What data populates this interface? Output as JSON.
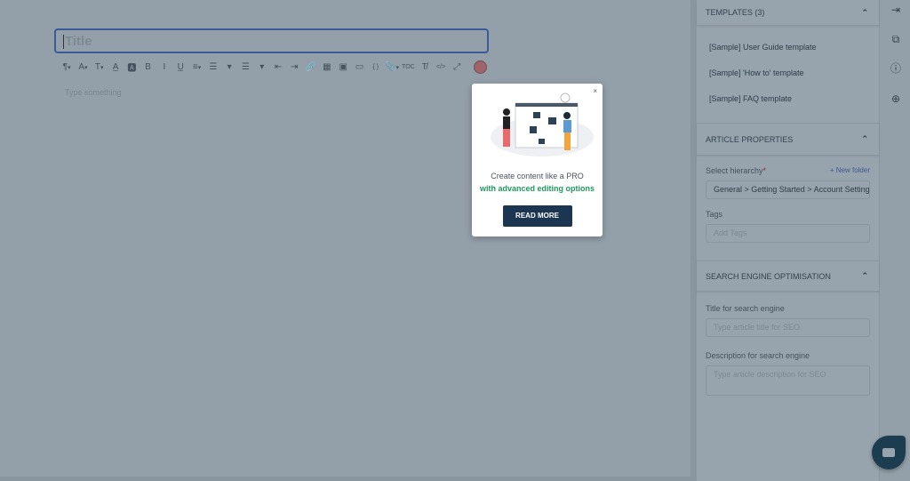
{
  "editor": {
    "title_placeholder": "Title",
    "body_placeholder": "Type something",
    "toolbar": [
      {
        "name": "paragraph-format",
        "glyph": "¶",
        "dd": true
      },
      {
        "name": "font-family",
        "glyph": "A",
        "dd": true
      },
      {
        "name": "font-size",
        "glyph": "T",
        "dd": true
      },
      {
        "name": "text-color",
        "glyph": "A̲",
        "dd": false
      },
      {
        "name": "background-color",
        "glyph": "🅰",
        "dd": false
      },
      {
        "name": "bold",
        "glyph": "B",
        "dd": false
      },
      {
        "name": "italic",
        "glyph": "I",
        "dd": false
      },
      {
        "name": "underline",
        "glyph": "U̲",
        "dd": false
      },
      {
        "name": "align",
        "glyph": "≡",
        "dd": true
      },
      {
        "name": "ordered-list",
        "glyph": "☰",
        "dd": false
      },
      {
        "name": "ordered-list-options",
        "glyph": "▾",
        "dd": false
      },
      {
        "name": "unordered-list",
        "glyph": "☰",
        "dd": false
      },
      {
        "name": "unordered-list-options",
        "glyph": "▾",
        "dd": false
      },
      {
        "name": "outdent",
        "glyph": "⇤",
        "dd": false
      },
      {
        "name": "indent",
        "glyph": "⇥",
        "dd": false
      },
      {
        "name": "link",
        "glyph": "🔗",
        "dd": false
      },
      {
        "name": "table",
        "glyph": "▦",
        "dd": false
      },
      {
        "name": "image",
        "glyph": "▣",
        "dd": false
      },
      {
        "name": "video",
        "glyph": "▭",
        "dd": false
      },
      {
        "name": "code-block",
        "glyph": "{ }",
        "dd": false
      },
      {
        "name": "attachment",
        "glyph": "📎",
        "dd": true
      },
      {
        "name": "toc",
        "glyph": "TOC",
        "dd": false
      },
      {
        "name": "clear-formatting",
        "glyph": "T̸",
        "dd": false
      },
      {
        "name": "html",
        "glyph": "</>",
        "dd": false
      },
      {
        "name": "fullscreen",
        "glyph": "⤢",
        "dd": false
      }
    ],
    "accent_color": "#a0636a"
  },
  "popup": {
    "close": "×",
    "line1": "Create content like a PRO",
    "line2": "with advanced editing options",
    "button": "READ MORE",
    "highlight_color": "#1e9a5e",
    "button_color": "#1c3550"
  },
  "sidebar": {
    "templates": {
      "header": "TEMPLATES (3)",
      "items": [
        "[Sample] User Guide template",
        "[Sample] 'How to' template",
        "[Sample] FAQ template"
      ]
    },
    "properties": {
      "header": "ARTICLE PROPERTIES",
      "hierarchy_label": "Select hierarchy",
      "required": "*",
      "new_folder": "+ New folder",
      "hierarchy_value": "General > Getting Started > Account Settings",
      "tags_label": "Tags",
      "tags_placeholder": "Add Tags"
    },
    "seo": {
      "header": "SEARCH ENGINE OPTIMISATION",
      "title_label": "Title for search engine",
      "title_placeholder": "Type article title for SEO",
      "desc_label": "Description for search engine",
      "desc_placeholder": "Type article description for SEO"
    }
  }
}
